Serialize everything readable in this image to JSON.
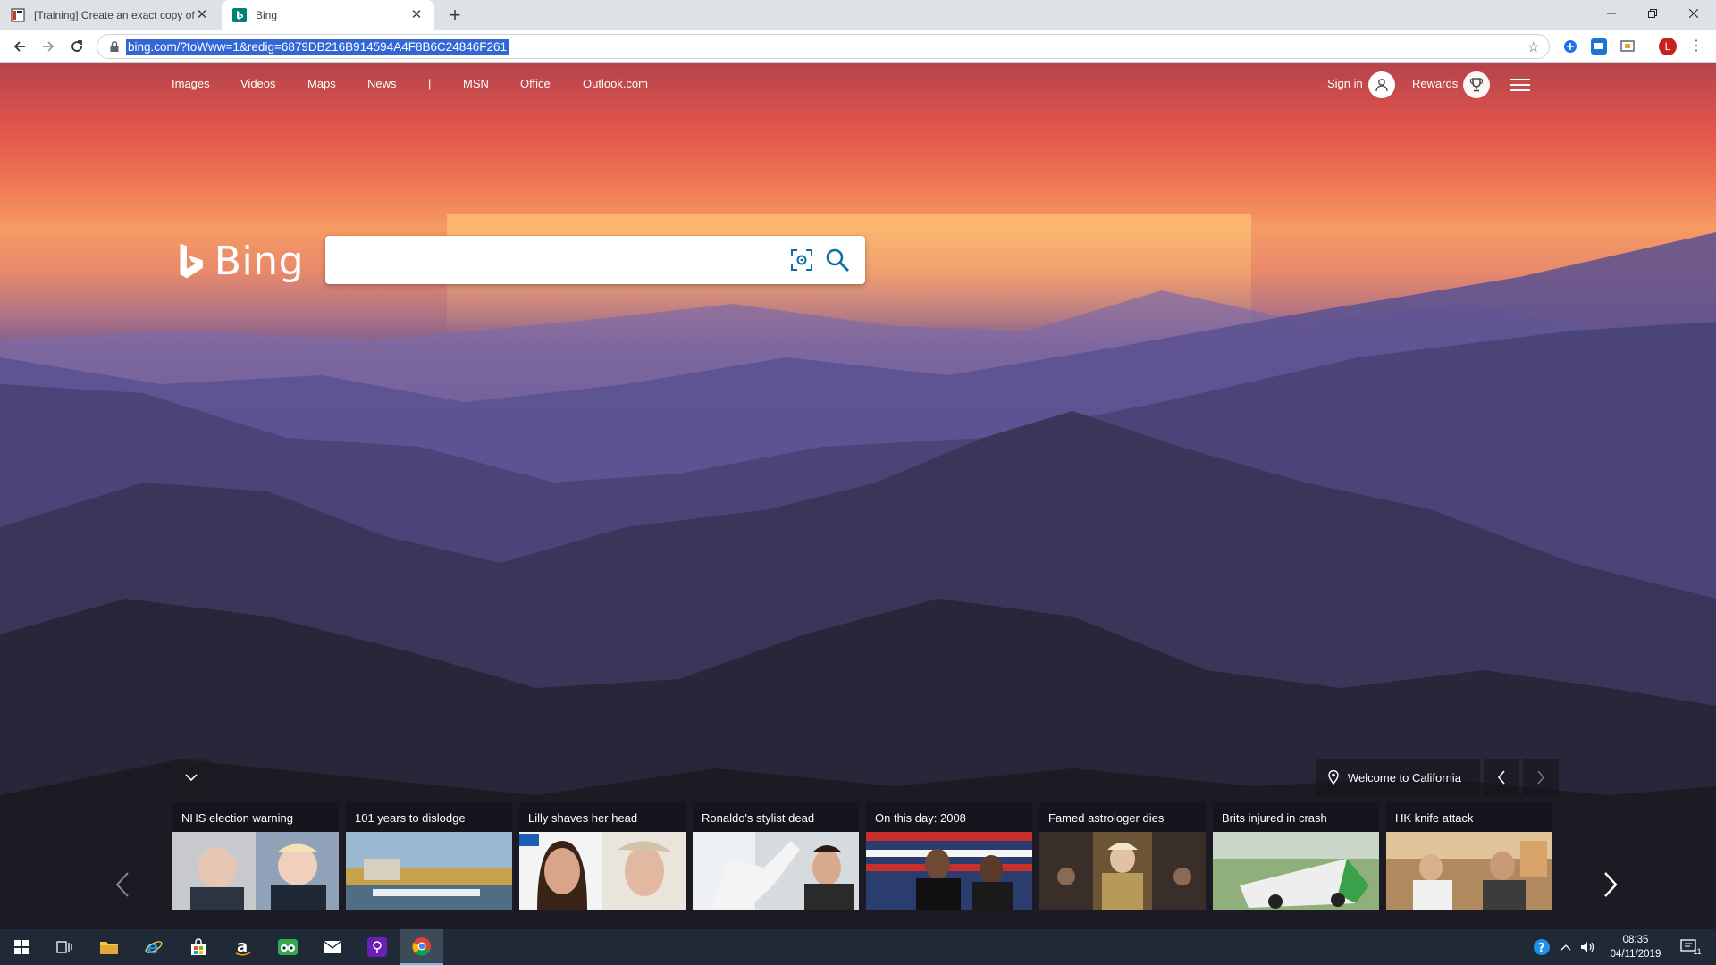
{
  "browser": {
    "tabs": [
      {
        "title": "[Training] Create an exact copy of",
        "active": false
      },
      {
        "title": "Bing",
        "active": true
      }
    ],
    "url": "bing.com/?toWww=1&redig=6879DB216B914594A4F8B6C24846F261",
    "profile_initial": "L"
  },
  "bing": {
    "nav_links": [
      "Images",
      "Videos",
      "Maps",
      "News",
      "|",
      "MSN",
      "Office",
      "Outlook.com"
    ],
    "sign_in": "Sign in",
    "rewards": "Rewards",
    "logo_text": "Bing",
    "search": {
      "value": "",
      "placeholder": ""
    },
    "location": "Welcome to California",
    "news": [
      {
        "title": "NHS election warning"
      },
      {
        "title": "101 years to dislodge"
      },
      {
        "title": "Lilly shaves her head"
      },
      {
        "title": "Ronaldo's stylist dead"
      },
      {
        "title": "On this day: 2008"
      },
      {
        "title": "Famed astrologer dies"
      },
      {
        "title": "Brits injured in crash"
      },
      {
        "title": "HK knife attack"
      }
    ]
  },
  "taskbar": {
    "time": "08:35",
    "date": "04/11/2019",
    "notification_count": "11"
  },
  "colors": {
    "accent": "#3367d6",
    "taskbar": "#1f2a36"
  }
}
